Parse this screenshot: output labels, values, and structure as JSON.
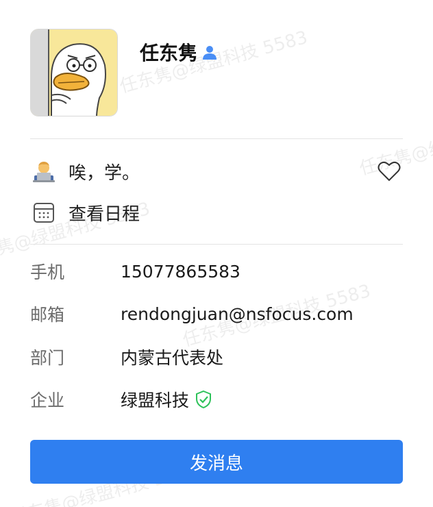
{
  "watermark": {
    "text": "任东隽@绿盟科技 5583"
  },
  "profile": {
    "name": "任东隽",
    "status_text": "唉，学。",
    "schedule_label": "查看日程"
  },
  "info": [
    {
      "label": "手机",
      "value": "15077865583"
    },
    {
      "label": "邮箱",
      "value": "rendongjuan@nsfocus.com"
    },
    {
      "label": "部门",
      "value": "内蒙古代表处"
    },
    {
      "label": "企业",
      "value": "绿盟科技"
    }
  ],
  "actions": {
    "send_message_label": "发消息"
  },
  "colors": {
    "accent": "#2f7ff0",
    "verified": "#2ec25a",
    "person_icon": "#4a8ef5"
  },
  "icons": {
    "person": "person-icon",
    "status_emoji": "technologist-emoji-icon",
    "calendar": "calendar-icon",
    "heart": "heart-outline-icon",
    "verified": "verified-shield-icon"
  }
}
